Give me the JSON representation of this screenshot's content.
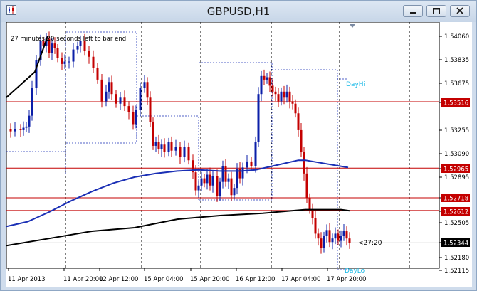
{
  "window": {
    "title": "GBPUSD,H1"
  },
  "chart": {
    "info_text": "27 minutes 20 seconds left to bar end",
    "countdown_label": "<27:20",
    "day_hi_label": "DayHi",
    "day_lo_label": "DayLo",
    "colors": {
      "bull_candle": "#0b1fa8",
      "bear_candle": "#c40000",
      "ma_fast": "#1a2fb5",
      "ma_slow": "#000000",
      "level_lines": "#c40000",
      "day_box": "#1a2fb5",
      "day_labels": "#16b8e6"
    },
    "price_axis": [
      "1.54060",
      "1.53835",
      "1.53675",
      "1.53516",
      "1.53255",
      "1.53090",
      "1.52965",
      "1.52895",
      "1.52718",
      "1.52612",
      "1.52505",
      "1.52344",
      "1.52180",
      "1.52115"
    ],
    "highlighted_prices": [
      {
        "label": "1.53516",
        "style": "red"
      },
      {
        "label": "1.52965",
        "style": "red"
      },
      {
        "label": "1.52718",
        "style": "red"
      },
      {
        "label": "1.52612",
        "style": "red"
      },
      {
        "label": "1.52344",
        "style": "black"
      }
    ],
    "time_axis": [
      "11 Apr 2013",
      "11 Apr 20:00",
      "12 Apr 12:00",
      "15 Apr 04:00",
      "15 Apr 20:00",
      "16 Apr 12:00",
      "17 Apr 04:00",
      "17 Apr 20:00"
    ]
  }
}
